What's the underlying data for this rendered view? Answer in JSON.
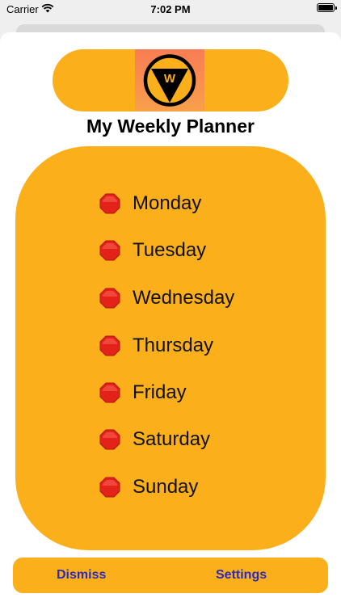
{
  "status_bar": {
    "carrier": "Carrier",
    "time": "7:02 PM",
    "wifi_icon": "wifi-icon",
    "battery_icon": "battery-icon"
  },
  "header": {
    "logo_letter": "W",
    "logo_icon": "pennant-w-logo",
    "title": "My Weekly Planner"
  },
  "days": [
    {
      "label": "Monday",
      "icon": "stop-sign-icon"
    },
    {
      "label": "Tuesday",
      "icon": "stop-sign-icon"
    },
    {
      "label": "Wednesday",
      "icon": "stop-sign-icon"
    },
    {
      "label": "Thursday",
      "icon": "stop-sign-icon"
    },
    {
      "label": "Friday",
      "icon": "stop-sign-icon"
    },
    {
      "label": "Saturday",
      "icon": "stop-sign-icon"
    },
    {
      "label": "Sunday",
      "icon": "stop-sign-icon"
    }
  ],
  "footer": {
    "dismiss_label": "Dismiss",
    "settings_label": "Settings"
  },
  "colors": {
    "accent": "#fbb01b",
    "button_text": "#2d2ab5",
    "stop_red": "#e3231a"
  }
}
